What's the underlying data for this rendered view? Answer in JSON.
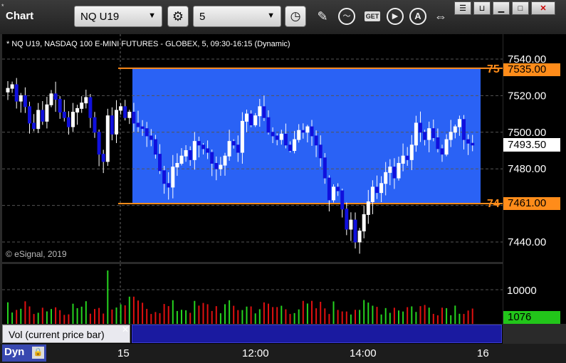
{
  "app": {
    "title": "Chart"
  },
  "toolbar": {
    "symbol": "NQ U19",
    "interval": "5"
  },
  "chart": {
    "description": "* NQ U19, NASDAQ 100 E-MINI FUTURES - GLOBEX, 5, 09:30-16:15 (Dynamic)",
    "copyright": "© eSignal, 2019",
    "price_ticks": [
      "7540.00",
      "7520.00",
      "7500.00",
      "7480.00",
      "7460.00",
      "7440.00"
    ],
    "levels": [
      {
        "short": "75",
        "value": "7535.00"
      },
      {
        "short": "74",
        "value": "7461.00"
      }
    ],
    "current_price": "7493.50",
    "time_labels": [
      "15",
      "12:00",
      "14:00",
      "16"
    ],
    "zone_color": "#2a62f5",
    "level_color": "#ff8c1a"
  },
  "volume": {
    "label": "Vol (current price bar)",
    "tick": "10000",
    "current": "1076",
    "current_color": "#22c51a"
  },
  "footer": {
    "mode": "Dyn"
  }
}
